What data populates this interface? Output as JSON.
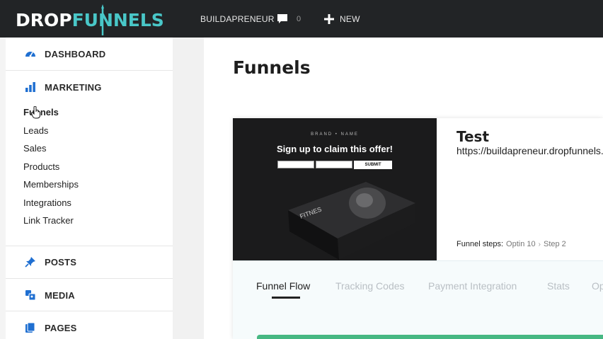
{
  "topbar": {
    "logo_part1": "DROP",
    "logo_part2": "FUNNELS",
    "site_name": "BUILDAPRENEUR",
    "comments_count": "0",
    "new_label": "NEW"
  },
  "sidebar": {
    "dashboard": "DASHBOARD",
    "marketing": "MARKETING",
    "marketing_items": [
      "Funnels",
      "Leads",
      "Sales",
      "Products",
      "Memberships",
      "Integrations",
      "Link Tracker"
    ],
    "posts": "POSTS",
    "media": "MEDIA",
    "pages": "PAGES"
  },
  "main": {
    "page_title": "Funnels",
    "funnel": {
      "thumbnail": {
        "brand": "BRAND • NAME",
        "headline": "Sign up to claim this offer!",
        "submit": "SUBMIT",
        "product_label": "FITNES"
      },
      "name": "Test",
      "url": "https://buildapreneur.dropfunnels.com",
      "steps_label": "Funnel steps:",
      "steps": [
        "Optin 10",
        "Step 2"
      ]
    },
    "tabs": [
      "Funnel Flow",
      "Tracking Codes",
      "Payment Integration",
      "Stats",
      "Op"
    ]
  },
  "colors": {
    "topbar": "#222426",
    "brand_teal": "#49c7c8",
    "sidebar_icon": "#1f6fd1",
    "progress": "#47b883"
  },
  "icons": {
    "dashboard": "speedometer-icon",
    "marketing": "bar-chart-icon",
    "posts": "pin-icon",
    "media": "media-icon",
    "pages": "pages-icon",
    "comments": "speech-bubble-icon",
    "new": "plus-icon"
  }
}
